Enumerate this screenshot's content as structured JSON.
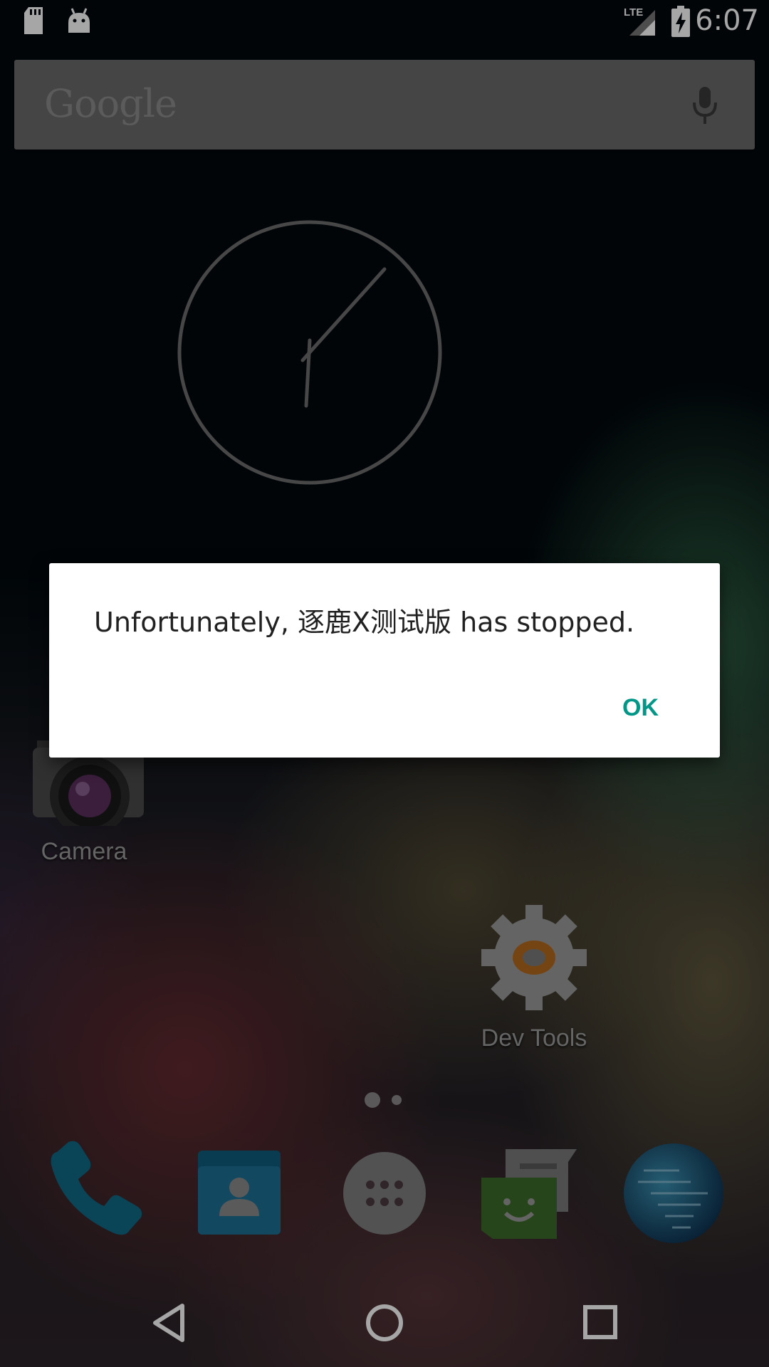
{
  "status_bar": {
    "time": "6:07",
    "network_label": "LTE",
    "icons": [
      "sd-card-icon",
      "android-debug-icon",
      "lte-signal-icon",
      "battery-charging-icon"
    ]
  },
  "search_bar": {
    "logo_text": "Google",
    "mic_icon": "microphone-icon"
  },
  "clock_widget": {
    "type": "analog-clock"
  },
  "desktop_apps": [
    {
      "label": "Camera",
      "icon": "camera-icon"
    },
    {
      "label": "Dev Tools",
      "icon": "gear-icon"
    }
  ],
  "page_indicator": {
    "pages": 2,
    "current": 1
  },
  "dock": [
    {
      "name": "Phone",
      "icon": "phone-icon"
    },
    {
      "name": "Contacts",
      "icon": "contacts-icon"
    },
    {
      "name": "App drawer",
      "icon": "app-drawer-icon"
    },
    {
      "name": "Messaging",
      "icon": "messaging-icon"
    },
    {
      "name": "Browser",
      "icon": "globe-icon"
    }
  ],
  "nav_bar": {
    "icons": [
      "back-icon",
      "home-icon",
      "recents-icon"
    ]
  },
  "dialog": {
    "message": "Unfortunately, 逐鹿X测试版 has stopped.",
    "ok_label": "OK",
    "accent_color": "#009688"
  }
}
